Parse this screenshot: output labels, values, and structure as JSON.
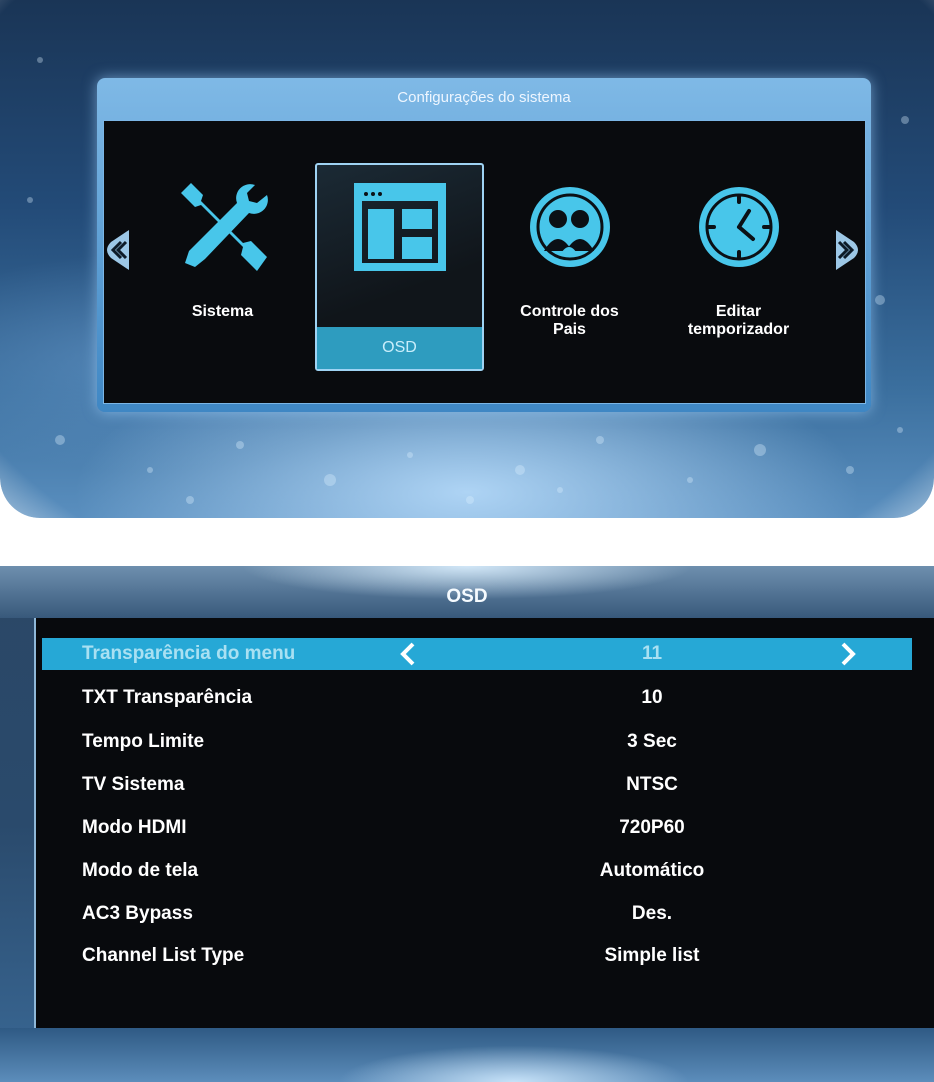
{
  "system_menu": {
    "title": "Configurações do sistema",
    "items": [
      {
        "label": "Sistema",
        "icon": "tools-icon"
      },
      {
        "label": "OSD",
        "icon": "window-layout-icon",
        "selected": true
      },
      {
        "label_line1": "Controle dos",
        "label_line2": "Pais",
        "icon": "parental-control-icon"
      },
      {
        "label_line1": "Editar",
        "label_line2": "temporizador",
        "icon": "clock-icon"
      }
    ],
    "nav": {
      "left_icon": "chevron-left-icon",
      "right_icon": "chevron-right-icon"
    }
  },
  "osd_menu": {
    "title": "OSD",
    "rows": [
      {
        "label": "Transparência do menu",
        "value": "11",
        "highlighted": true
      },
      {
        "label": "TXT Transparência",
        "value": "10"
      },
      {
        "label": "Tempo Limite",
        "value": "3 Sec"
      },
      {
        "label": "TV Sistema",
        "value": "NTSC"
      },
      {
        "label": "Modo HDMI",
        "value": "720P60"
      },
      {
        "label": "Modo de tela",
        "value": "Automático"
      },
      {
        "label": "AC3 Bypass",
        "value": "Des."
      },
      {
        "label": "Channel List Type",
        "value": "Simple list"
      }
    ]
  },
  "colors": {
    "accent": "#26a8d6",
    "icon": "#48c6ea",
    "panel_border": "#7bb6e5",
    "body_bg": "#080a0d"
  }
}
